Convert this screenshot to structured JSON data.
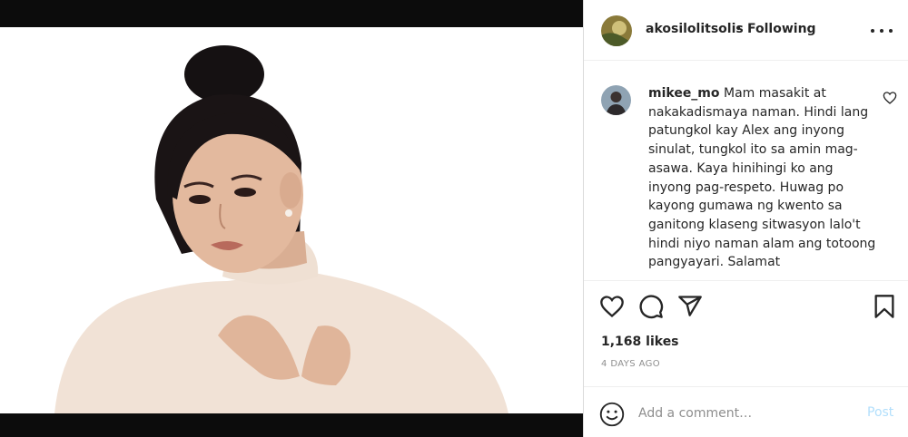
{
  "post": {
    "username": "akosilolitsolis",
    "separator": "•",
    "follow_status": "Following",
    "more_icon": "more-options-icon"
  },
  "comment": {
    "username": "mikee_mo",
    "text": "Mam masakit at nakakadismaya naman. Hindi lang patungkol kay Alex ang inyong sinulat, tungkol ito sa amin mag-asawa. Kaya hinihingi ko ang inyong pag-respeto. Huwag po kayong gumawa ng kwento sa ganitong klaseng sitwasyon lalo't hindi niyo naman alam ang totoong pangyayari. Salamat",
    "like_icon": "heart-outline-icon"
  },
  "actions": {
    "icons": [
      "heart-icon",
      "comment-bubble-icon",
      "share-arrow-icon",
      "bookmark-icon"
    ]
  },
  "likes": "1,168 likes",
  "timestamp": "4 DAYS AGO",
  "add_comment": {
    "placeholder": "Add a comment…",
    "post_label": "Post",
    "emoji_icon": "emoji-smiley-icon"
  },
  "colors": {
    "text": "#262626",
    "muted": "#8e8e8e",
    "post_disabled": "#b2dffc",
    "letterbox": "#0c0c0c",
    "divider": "#efefef"
  }
}
